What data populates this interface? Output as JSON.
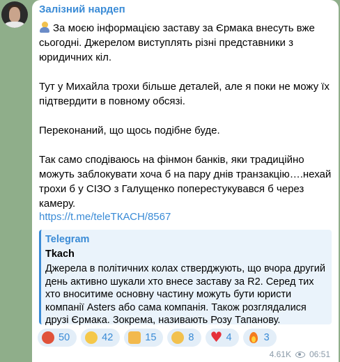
{
  "channel": {
    "name": "Залізний нардеп"
  },
  "message": {
    "paragraphs": [
      "За моєю інформацією заставу за Єрмака внесуть вже сьогодні. Джерелом виступлять різні представники з юридичних кіл.",
      "Тут у Михайла трохи більше деталей, але я поки не можу їх підтвердити в повному обсязі.",
      "Переконаний, що щось подібне буде.",
      "Так само сподіваюсь на фінмон банків, яки традиційно можуть заблокувати хоча б на пару днів транзакцію….нехай трохи б у СІЗО з Галущенко поперестукувався б через камеру."
    ],
    "link": "https://t.me/teleТКАСН/8567"
  },
  "preview": {
    "source": "Telegram",
    "title": "Tkach",
    "text": "Джерела в політичних колах стверджують, що вчора другий день активно шукали хто внесе заставу за R2. Серед тих хто вноситиме основну частину можуть бути юристи компанії Asters або сама компанія. Також розглядалися друзі Єрмака. Зокрема, називають Розу Тапанову."
  },
  "reactions": [
    {
      "icon": "enraged-face-icon",
      "count": "50"
    },
    {
      "icon": "exploding-head-icon",
      "count": "42"
    },
    {
      "icon": "thumbs-up-icon",
      "count": "15"
    },
    {
      "icon": "rofl-icon",
      "count": "8"
    },
    {
      "icon": "red-heart-icon",
      "count": "4"
    },
    {
      "icon": "fire-icon",
      "count": "3"
    }
  ],
  "meta": {
    "views": "4.61K",
    "time": "06:51"
  },
  "colors": {
    "accent": "#3a8bd6",
    "background": "#8fae8a",
    "quote_bg": "#eaf3fb"
  }
}
